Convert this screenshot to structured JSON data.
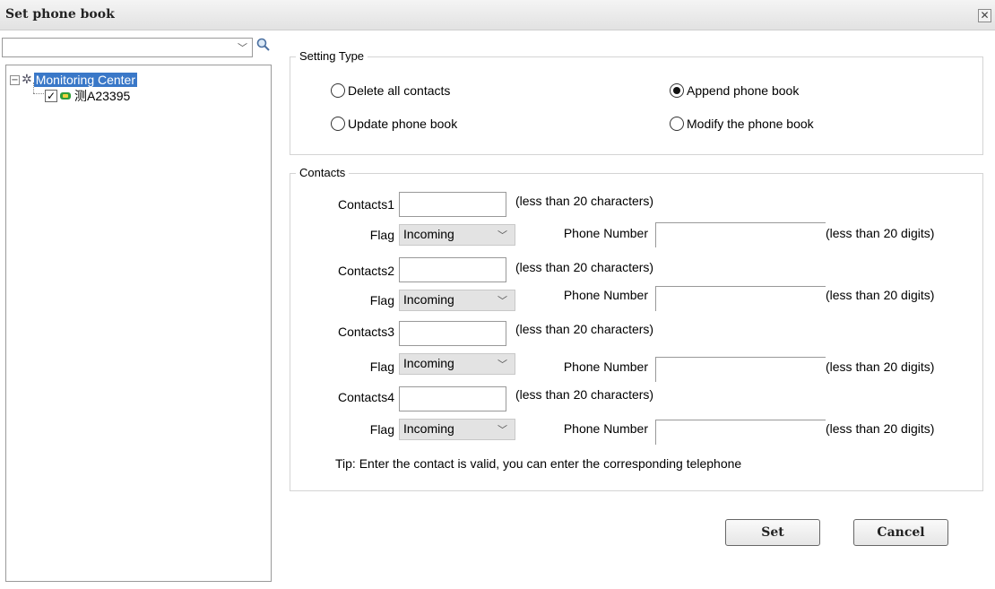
{
  "dialog": {
    "title": "Set phone book",
    "close_icon": "close-icon"
  },
  "tree": {
    "root_label": "Monitoring Center",
    "root_expander": "−",
    "vehicle_label": "测A23395",
    "vehicle_checked": true
  },
  "setting_type": {
    "legend": "Setting Type",
    "options": [
      {
        "label": "Delete all contacts",
        "selected": false
      },
      {
        "label": "Append phone book",
        "selected": true
      },
      {
        "label": "Update phone book",
        "selected": false
      },
      {
        "label": "Modify the phone book",
        "selected": false
      }
    ]
  },
  "contacts": {
    "legend": "Contacts",
    "name_hint": "(less than 20 characters)",
    "phone_hint": "(less than 20 digits)",
    "flag_label": "Flag",
    "phone_label": "Phone Number",
    "rows": [
      {
        "label": "Contacts1",
        "name": "",
        "flag": "Incoming",
        "phone": ""
      },
      {
        "label": "Contacts2",
        "name": "",
        "flag": "Incoming",
        "phone": ""
      },
      {
        "label": "Contacts3",
        "name": "",
        "flag": "Incoming",
        "phone": ""
      },
      {
        "label": "Contacts4",
        "name": "",
        "flag": "Incoming",
        "phone": ""
      }
    ],
    "tip": "Tip: Enter the contact is valid, you can enter the corresponding telephone"
  },
  "buttons": {
    "set": "Set",
    "cancel": "Cancel"
  },
  "colors": {
    "selection": "#3a78c8",
    "title_bar": "#e8e8e8"
  }
}
